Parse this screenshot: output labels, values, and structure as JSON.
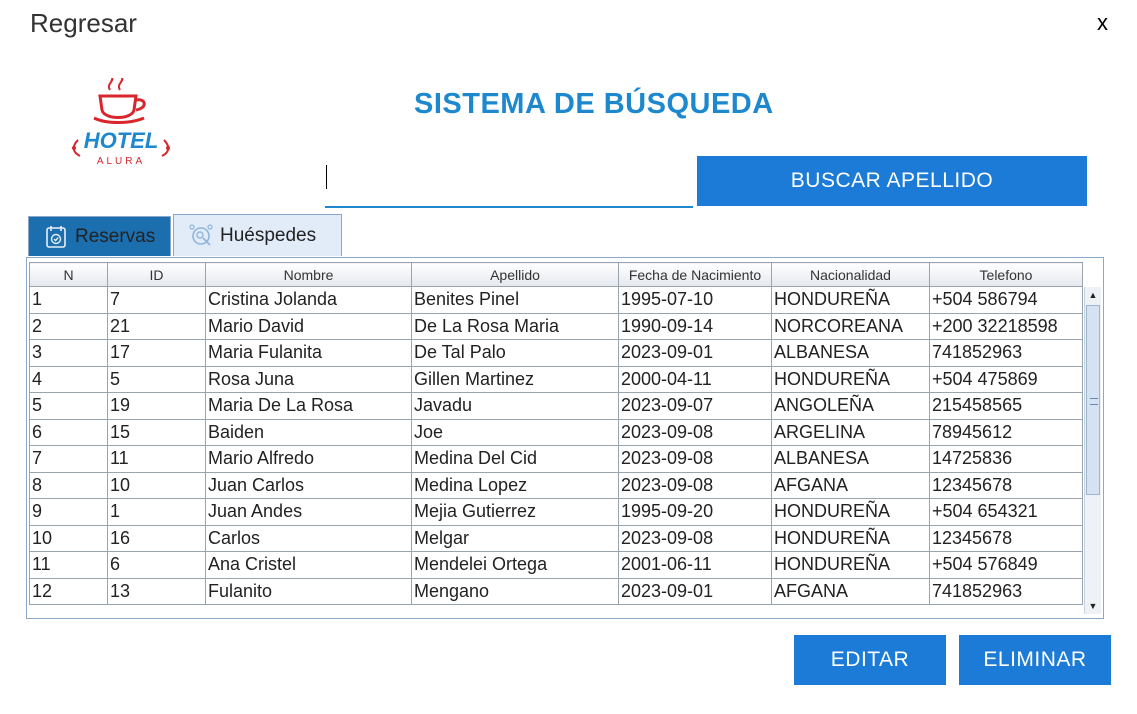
{
  "header": {
    "back_label": "Regresar",
    "close_label": "x"
  },
  "logo": {
    "text": "HOTEL",
    "subtext": "ALURA"
  },
  "title": "SISTEMA DE BÚSQUEDA",
  "search": {
    "value": "",
    "button_label": "BUSCAR APELLIDO"
  },
  "tabs": [
    {
      "label": "Reservas",
      "icon": "reservations-icon",
      "selected": false
    },
    {
      "label": "Huéspedes",
      "icon": "guests-icon",
      "selected": true
    }
  ],
  "table": {
    "columns": [
      "N",
      "ID",
      "Nombre",
      "Apellido",
      "Fecha de Nacimiento",
      "Nacionalidad",
      "Telefono"
    ],
    "rows": [
      [
        "1",
        "7",
        "Cristina Jolanda",
        "Benites Pinel",
        "1995-07-10",
        "HONDUREÑA",
        "+504 586794"
      ],
      [
        "2",
        "21",
        "Mario David",
        "De La Rosa Maria",
        "1990-09-14",
        "NORCOREANA",
        "+200 32218598"
      ],
      [
        "3",
        "17",
        "Maria Fulanita",
        "De Tal Palo",
        "2023-09-01",
        "ALBANESA",
        "741852963"
      ],
      [
        "4",
        "5",
        "Rosa Juna",
        "Gillen Martinez",
        "2000-04-11",
        "HONDUREÑA",
        "+504 475869"
      ],
      [
        "5",
        "19",
        "Maria De La Rosa",
        "Javadu",
        "2023-09-07",
        "ANGOLEÑA",
        "215458565"
      ],
      [
        "6",
        "15",
        "Baiden",
        "Joe",
        "2023-09-08",
        "ARGELINA",
        "78945612"
      ],
      [
        "7",
        "11",
        "Mario Alfredo",
        "Medina Del Cid",
        "2023-09-08",
        "ALBANESA",
        "14725836"
      ],
      [
        "8",
        "10",
        "Juan Carlos",
        "Medina Lopez",
        "2023-09-08",
        "AFGANA",
        "12345678"
      ],
      [
        "9",
        "1",
        "Juan Andes",
        "Mejia Gutierrez",
        "1995-09-20",
        "HONDUREÑA",
        "+504 654321"
      ],
      [
        "10",
        "16",
        "Carlos",
        "Melgar",
        "2023-09-08",
        "HONDUREÑA",
        "12345678"
      ],
      [
        "11",
        "6",
        "Ana Cristel",
        "Mendelei Ortega",
        "2001-06-11",
        "HONDUREÑA",
        "+504 576849"
      ],
      [
        "12",
        "13",
        "Fulanito",
        "Mengano",
        "2023-09-01",
        "AFGANA",
        "741852963"
      ]
    ]
  },
  "actions": {
    "edit_label": "EDITAR",
    "delete_label": "ELIMINAR"
  },
  "colors": {
    "accent": "#1e88cf",
    "button": "#1b7bd6",
    "logo_red": "#d8262c"
  }
}
